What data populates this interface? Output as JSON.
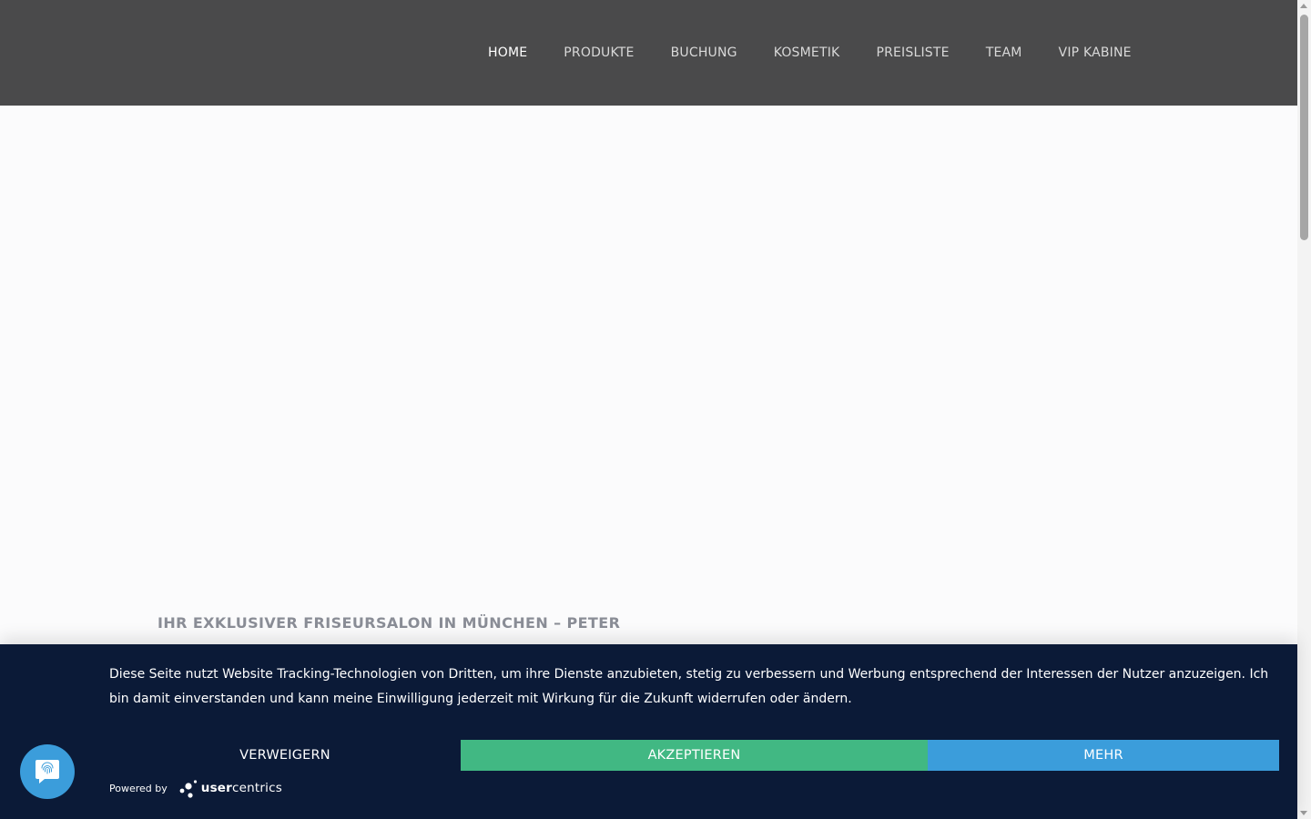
{
  "nav": {
    "items": [
      {
        "label": "HOME",
        "active": true
      },
      {
        "label": "PRODUKTE",
        "active": false
      },
      {
        "label": "BUCHUNG",
        "active": false
      },
      {
        "label": "KOSMETIK",
        "active": false
      },
      {
        "label": "PREISLISTE",
        "active": false
      },
      {
        "label": "TEAM",
        "active": false
      },
      {
        "label": "VIP KABINE",
        "active": false
      }
    ]
  },
  "hero": {
    "headline": "IHR EXKLUSIVER FRISEURSALON IN MÜNCHEN – PETER"
  },
  "cookie_banner": {
    "text": "Diese Seite nutzt Website Tracking-Technologien von Dritten, um ihre Dienste anzubieten, stetig zu verbessern und Werbung entsprechend der Interessen der Nutzer anzuzeigen. Ich bin damit einverstanden und kann meine Einwilligung jederzeit mit Wirkung für die Zukunft widerrufen oder ändern.",
    "deny_label": "VERWEIGERN",
    "accept_label": "AKZEPTIEREN",
    "more_label": "MEHR",
    "powered_by": "Powered by",
    "brand_bold": "user",
    "brand_rest": "centrics"
  },
  "colors": {
    "header_bg": "#4a4a4b",
    "banner_bg": "#0b1a37",
    "accept": "#41b883",
    "more": "#3b9ddb"
  },
  "icons": {
    "privacy": "fingerprint-chat-icon",
    "brand": "usercentrics-logo-icon"
  }
}
